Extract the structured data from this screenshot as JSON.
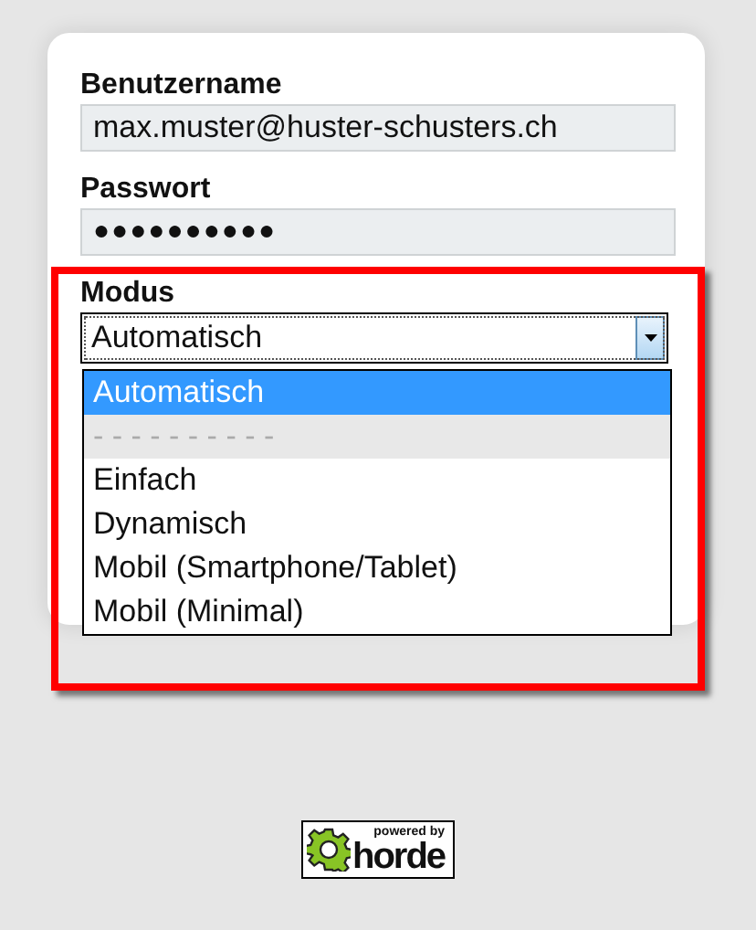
{
  "form": {
    "fields": [
      {
        "kind": "text",
        "label": "Benutzername",
        "value": "max.muster@huster-schusters.ch"
      },
      {
        "kind": "password",
        "label": "Passwort",
        "value": "●●●●●●●●●●"
      }
    ],
    "mode": {
      "label": "Modus",
      "value": "Automatisch",
      "expanded": true,
      "options": [
        {
          "label": "Automatisch",
          "selected": true,
          "disabled": false
        },
        {
          "label": "- - - - - - - - - -",
          "selected": false,
          "disabled": true
        },
        {
          "label": "Einfach",
          "selected": false,
          "disabled": false
        },
        {
          "label": "Dynamisch",
          "selected": false,
          "disabled": false
        },
        {
          "label": "Mobil (Smartphone/Tablet)",
          "selected": false,
          "disabled": false
        },
        {
          "label": "Mobil (Minimal)",
          "selected": false,
          "disabled": false
        }
      ]
    }
  },
  "logo": {
    "caption": "powered by",
    "name": "horde"
  }
}
